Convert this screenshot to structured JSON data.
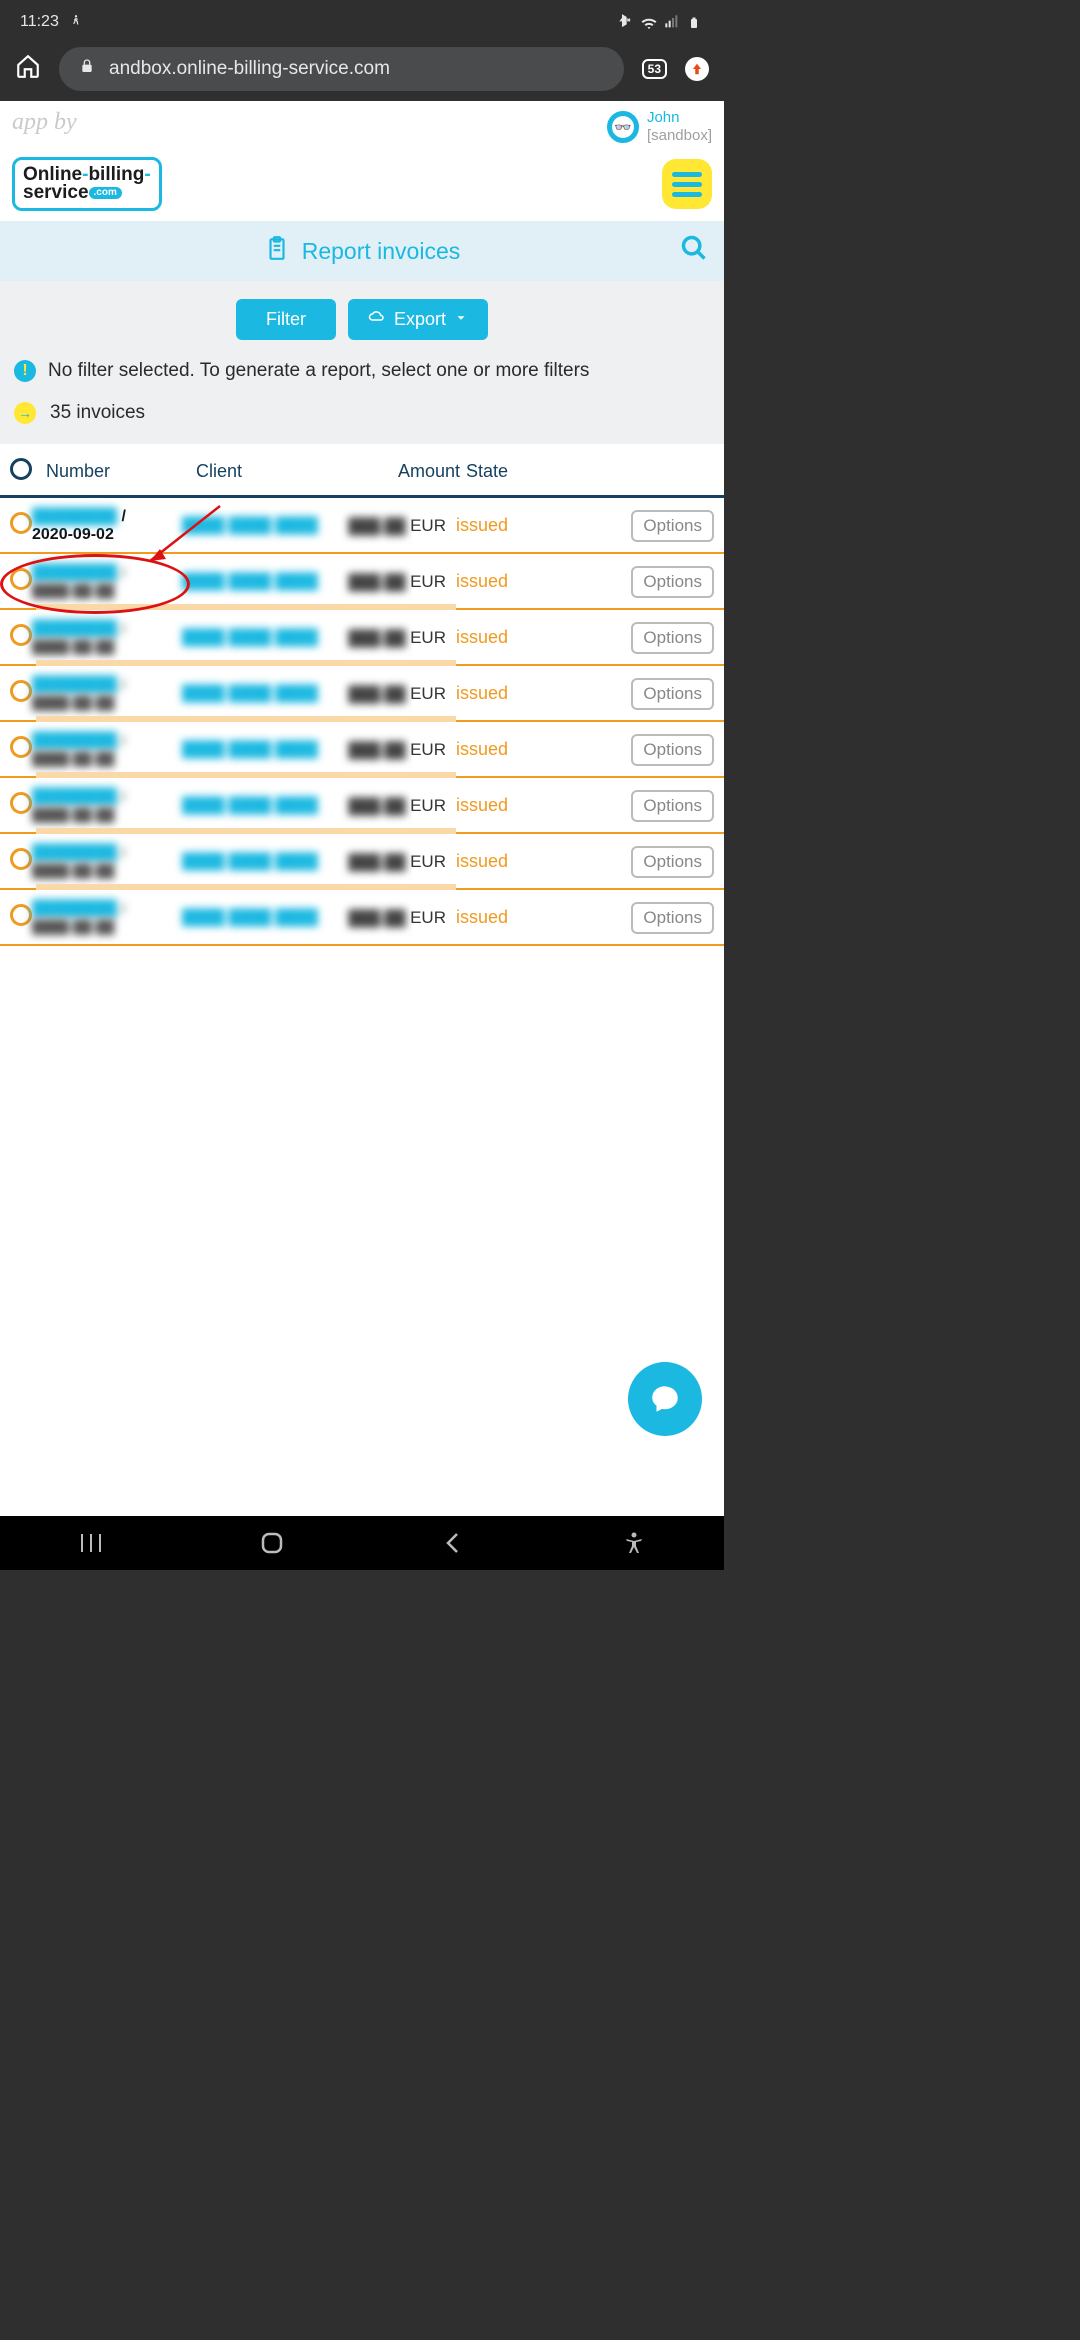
{
  "status": {
    "time": "11:23"
  },
  "browser": {
    "url": "andbox.online-billing-service.com",
    "tabs": "53"
  },
  "appby": "app by",
  "user": {
    "name": "John",
    "context": "[sandbox]"
  },
  "logo": {
    "line1_a": "Online",
    "line1_b": "billing",
    "line2": "service",
    "badge": ".com"
  },
  "titlebar": {
    "label": "Report invoices"
  },
  "buttons": {
    "filter": "Filter",
    "export": "Export"
  },
  "info": "No filter selected. To generate a report, select one or more filters",
  "count": "35 invoices",
  "columns": {
    "number": "Number",
    "client": "Client",
    "amount": "Amount",
    "state": "State"
  },
  "rows": [
    {
      "num_blur": "████████",
      "date": "2020-09-02",
      "client_blur": "████ ████ ████",
      "amt_blur": "███.██",
      "cur": "EUR",
      "state": "issued",
      "opt": "Options",
      "underline": 724,
      "fade": 0,
      "show_date_clear": true
    },
    {
      "num_blur": "████████",
      "date": "████-██-██",
      "client_blur": "████ ████ ████",
      "amt_blur": "███.██",
      "cur": "EUR",
      "state": "issued",
      "opt": "Options",
      "underline": 724,
      "fade": 420
    },
    {
      "num_blur": "████████",
      "date": "████-██-██",
      "client_blur": "████ ████ ████",
      "amt_blur": "███.██",
      "cur": "EUR",
      "state": "issued",
      "opt": "Options",
      "underline": 724,
      "fade": 420
    },
    {
      "num_blur": "████████",
      "date": "████-██-██",
      "client_blur": "████ ████ ████",
      "amt_blur": "███.██",
      "cur": "EUR",
      "state": "issued",
      "opt": "Options",
      "underline": 724,
      "fade": 420
    },
    {
      "num_blur": "████████",
      "date": "████-██-██",
      "client_blur": "████ ████ ████",
      "amt_blur": "███.██",
      "cur": "EUR",
      "state": "issued",
      "opt": "Options",
      "underline": 724,
      "fade": 420
    },
    {
      "num_blur": "████████",
      "date": "████-██-██",
      "client_blur": "████ ████ ████",
      "amt_blur": "███.██",
      "cur": "EUR",
      "state": "issued",
      "opt": "Options",
      "underline": 724,
      "fade": 420
    },
    {
      "num_blur": "████████",
      "date": "████-██-██",
      "client_blur": "████ ████ ████",
      "amt_blur": "███.██",
      "cur": "EUR",
      "state": "issued",
      "opt": "Options",
      "underline": 724,
      "fade": 420
    },
    {
      "num_blur": "████████",
      "date": "████-██-██",
      "client_blur": "████ ████ ████",
      "amt_blur": "███.██",
      "cur": "EUR",
      "state": "issued",
      "opt": "Options",
      "underline": 724,
      "fade": 0
    }
  ]
}
